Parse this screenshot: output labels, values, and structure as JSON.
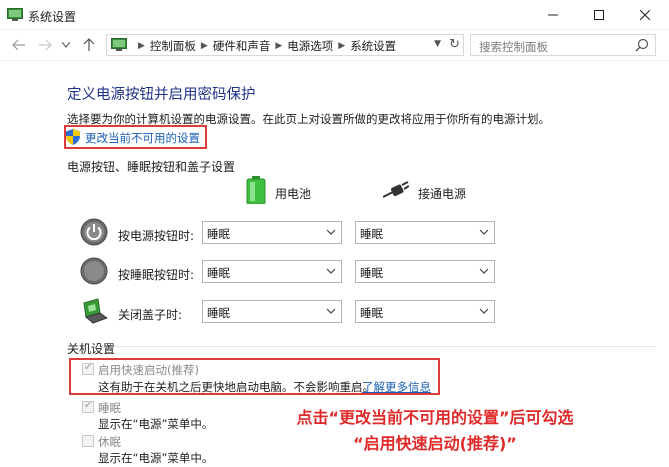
{
  "window": {
    "title": "系统设置"
  },
  "nav": {
    "breadcrumbs": [
      "控制面板",
      "硬件和声音",
      "电源选项",
      "系统设置"
    ],
    "search_placeholder": "搜索控制面板"
  },
  "page": {
    "title": "定义电源按钮并启用密码保护",
    "description": "选择要为你的计算机设置的电源设置。在此页上对设置所做的更改将应用于你所有的电源计划。",
    "change_link": "更改当前不可用的设置"
  },
  "power_buttons": {
    "section_label": "电源按钮、睡眠按钮和盖子设置",
    "col_battery": "用电池",
    "col_plugged": "接通电源",
    "rows": [
      {
        "label": "按电源按钮时:",
        "icon": "power-icon",
        "battery": "睡眠",
        "plugged": "睡眠"
      },
      {
        "label": "按睡眠按钮时:",
        "icon": "sleep-icon",
        "battery": "睡眠",
        "plugged": "睡眠"
      },
      {
        "label": "关闭盖子时:",
        "icon": "laptop-lid-icon",
        "battery": "睡眠",
        "plugged": "睡眠"
      }
    ]
  },
  "shutdown": {
    "section_label": "关机设置",
    "fast_startup": {
      "label": "启用快速启动(推荐)",
      "desc": "这有助于在关机之后更快地启动电脑。不会影响重启。",
      "learn_more": "了解更多信息",
      "checked": true
    },
    "sleep": {
      "label": "睡眠",
      "desc": "显示在“电源”菜单中。",
      "checked": true
    },
    "hibernate": {
      "label": "休眠",
      "desc": "显示在“电源”菜单中。",
      "checked": false
    }
  },
  "annotation": {
    "line1": "点击“更改当前不可用的设置”后可勾选",
    "line2": "“启用快速启动(推荐)”"
  },
  "colors": {
    "highlight_red": "#e03a3a",
    "title_blue": "#1e3287",
    "link_blue": "#1a5fb4"
  }
}
